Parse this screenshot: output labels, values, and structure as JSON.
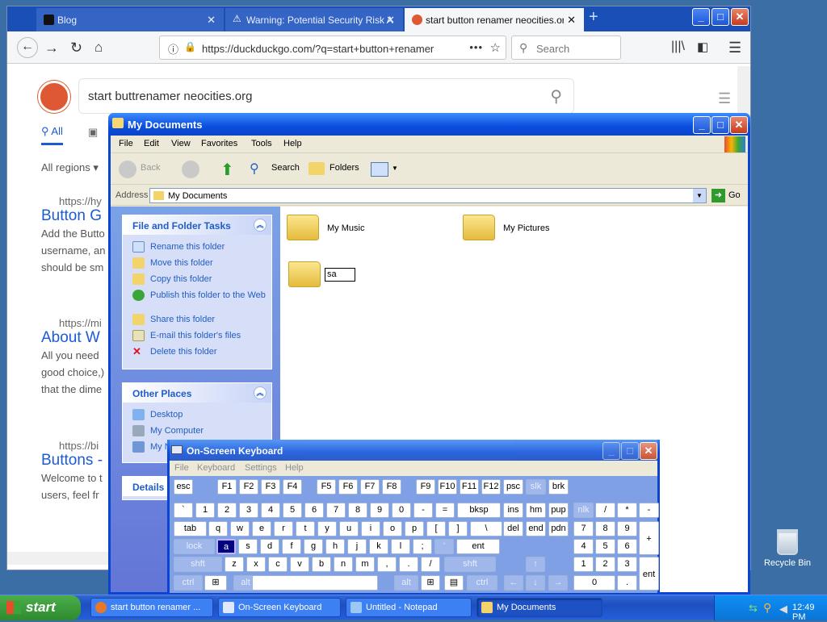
{
  "firefox": {
    "tabs": [
      {
        "label": "Blog",
        "active": false
      },
      {
        "label": "Warning: Potential Security Risk A",
        "active": false
      },
      {
        "label": "start button renamer neocities.org",
        "active": true
      }
    ],
    "url": "https://duckduckgo.com/?q=start+button+renamer",
    "search_placeholder": "Search"
  },
  "ddg": {
    "query": "start buttrenamer neocities.org",
    "tab_all": "All",
    "region": "All regions",
    "results": [
      {
        "url": "https://hy",
        "title": "Button G",
        "lines": [
          "Add the Butto",
          "username, an",
          "should be sm"
        ]
      },
      {
        "url": "https://mi",
        "title": "About W",
        "lines": [
          "All you need",
          "good choice,)",
          "that the dime"
        ]
      },
      {
        "url": "https://bi",
        "title": "Buttons -",
        "lines": [
          "Welcome to t",
          "users, feel fr"
        ]
      }
    ]
  },
  "mydocs": {
    "title": "My Documents",
    "menu": [
      "File",
      "Edit",
      "View",
      "Favorites",
      "Tools",
      "Help"
    ],
    "toolbar": {
      "back": "Back",
      "search": "Search",
      "folders": "Folders"
    },
    "address_label": "Address",
    "address_value": "My Documents",
    "go": "Go",
    "tasks_header": "File and Folder Tasks",
    "tasks": [
      "Rename this folder",
      "Move this folder",
      "Copy this folder",
      "Publish this folder to the Web",
      "Share this folder",
      "E-mail this folder's files",
      "Delete this folder"
    ],
    "places_header": "Other Places",
    "places": [
      "Desktop",
      "My Computer",
      "My N"
    ],
    "details_header": "Details",
    "items": [
      "My Music",
      "My Pictures"
    ],
    "rename_value": "sa"
  },
  "osk": {
    "title": "On-Screen Keyboard",
    "menu": [
      "File",
      "Keyboard",
      "Settings",
      "Help"
    ],
    "rows": [
      [
        "esc",
        "F1",
        "F2",
        "F3",
        "F4",
        "F5",
        "F6",
        "F7",
        "F8",
        "F9",
        "F10",
        "F11",
        "F12",
        "psc",
        "slk",
        "brk"
      ],
      [
        "`",
        "1",
        "2",
        "3",
        "4",
        "5",
        "6",
        "7",
        "8",
        "9",
        "0",
        "-",
        "=",
        "bksp",
        "ins",
        "hm",
        "pup",
        "nlk",
        "/",
        "*",
        "-"
      ],
      [
        "tab",
        "q",
        "w",
        "e",
        "r",
        "t",
        "y",
        "u",
        "i",
        "o",
        "p",
        "[",
        "]",
        "\\",
        "del",
        "end",
        "pdn",
        "7",
        "8",
        "9",
        "+"
      ],
      [
        "lock",
        "a",
        "s",
        "d",
        "f",
        "g",
        "h",
        "j",
        "k",
        "l",
        ";",
        "'",
        "ent",
        "4",
        "5",
        "6"
      ],
      [
        "shft",
        "z",
        "x",
        "c",
        "v",
        "b",
        "n",
        "m",
        ",",
        ".",
        "/",
        "shft",
        "1",
        "2",
        "3",
        "ent"
      ],
      [
        "ctrl",
        "alt",
        "alt",
        "ctrl",
        "0",
        "."
      ]
    ]
  },
  "desktop": {
    "recycle_bin": "Recycle Bin"
  },
  "taskbar": {
    "start": "start",
    "tasks": [
      "start button renamer ...",
      "On-Screen Keyboard",
      "Untitled - Notepad",
      "My Documents"
    ],
    "clock": "12:49 PM"
  },
  "colors": {
    "xp_blue": "#0a44d1",
    "desktop": "#3a6ea5",
    "link": "#215dc6",
    "ddg_orange": "#de5833"
  }
}
